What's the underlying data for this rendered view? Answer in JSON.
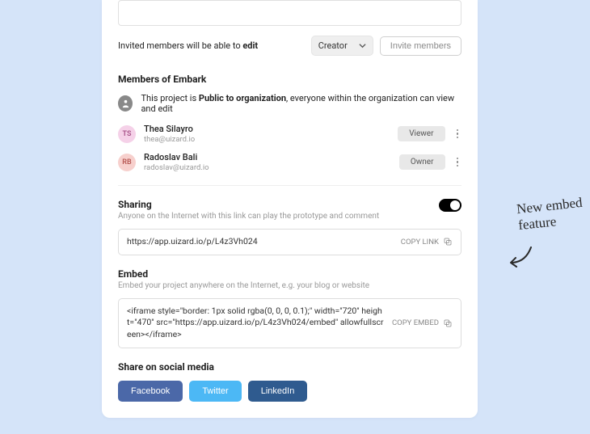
{
  "invite": {
    "text_prefix": "Invited members will be able to ",
    "text_bold": "edit",
    "role_selected": "Creator",
    "button_label": "Invite members"
  },
  "members": {
    "title": "Members of Embark",
    "visibility_prefix": "This project is ",
    "visibility_bold": "Public to organization",
    "visibility_suffix": ", everyone within the organization can view and edit",
    "list": [
      {
        "initials": "TS",
        "name": "Thea Silayro",
        "email": "thea@uizard.io",
        "role": "Viewer"
      },
      {
        "initials": "RB",
        "name": "Radoslav Bali",
        "email": "radoslav@uizard.io",
        "role": "Owner"
      }
    ]
  },
  "sharing": {
    "title": "Sharing",
    "subtitle": "Anyone on the Internet with this link can play the prototype and comment",
    "link": "https://app.uizard.io/p/L4z3Vh024",
    "copy_link_label": "COPY LINK"
  },
  "embed": {
    "title": "Embed",
    "subtitle": "Embed your project anywhere on the Internet, e.g. your blog or website",
    "code": "<iframe style=\"border: 1px solid rgba(0, 0, 0, 0.1);\" width=\"720\" height=\"470\" src=\"https://app.uizard.io/p/L4z3Vh024/embed\" allowfullscreen></iframe>",
    "copy_embed_label": "COPY EMBED"
  },
  "social": {
    "title": "Share on social media",
    "facebook": "Facebook",
    "twitter": "Twitter",
    "linkedin": "LinkedIn"
  },
  "annotation": {
    "line1": "New embed",
    "line2": "feature"
  }
}
